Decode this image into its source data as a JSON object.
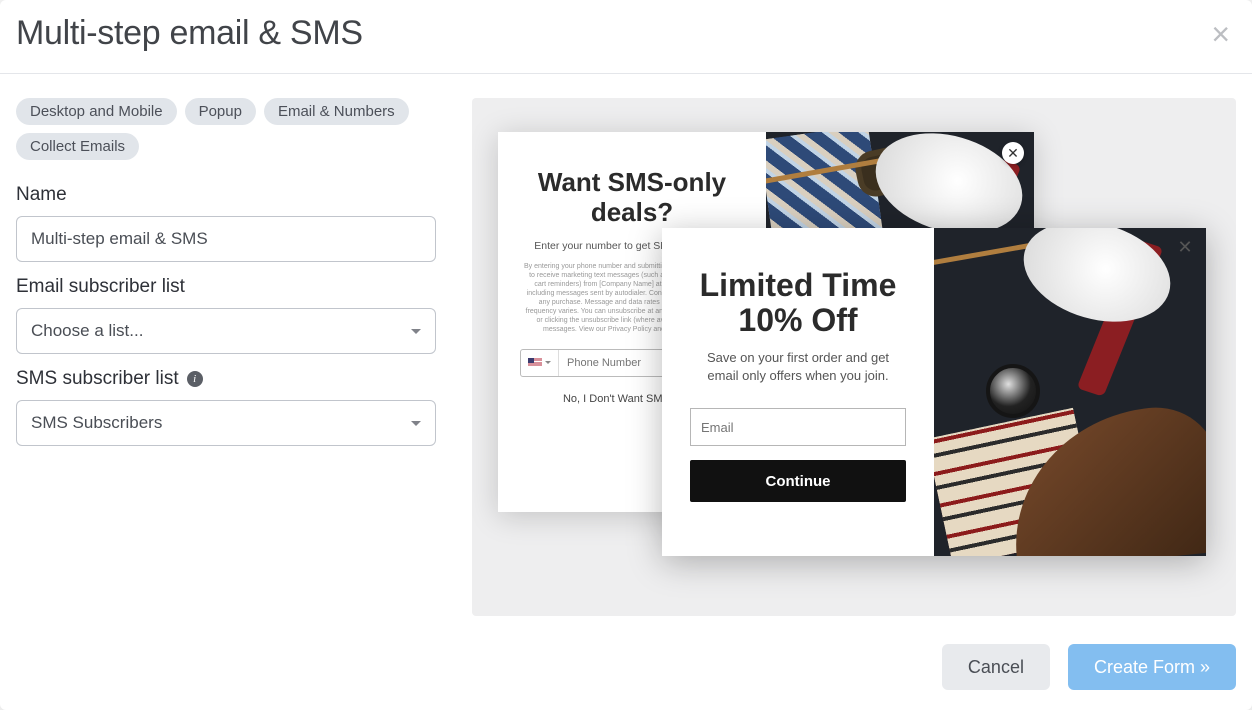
{
  "header": {
    "title": "Multi-step email & SMS"
  },
  "tags": [
    "Desktop and Mobile",
    "Popup",
    "Email & Numbers",
    "Collect Emails"
  ],
  "fields": {
    "name_label": "Name",
    "name_value": "Multi-step email & SMS",
    "email_list_label": "Email subscriber list",
    "email_list_value": "Choose a list...",
    "sms_list_label": "SMS subscriber list",
    "sms_list_value": "SMS Subscribers"
  },
  "preview": {
    "sms": {
      "heading": "Want SMS-only deals?",
      "sub": "Enter your number to get SMS-only deals.",
      "legal": "By entering your phone number and submitting this form, you consent to receive marketing text messages (such as promotion codes and cart reminders) from [Company Name] at the number provided, including messages sent by autodialer. Consent is not a condition of any purchase. Message and data rates may apply. Message frequency varies. You can unsubscribe at any time by replying STOP or clicking the unsubscribe link (where available) in one of our messages. View our Privacy Policy and Terms of Service.",
      "phone_placeholder": "Phone Number",
      "decline": "No, I Don't Want SMS Deals"
    },
    "email": {
      "heading": "Limited Time 10% Off",
      "sub": "Save on your first order and get email only offers when you join.",
      "placeholder": "Email",
      "cta": "Continue"
    }
  },
  "footer": {
    "cancel": "Cancel",
    "create": "Create Form »"
  }
}
